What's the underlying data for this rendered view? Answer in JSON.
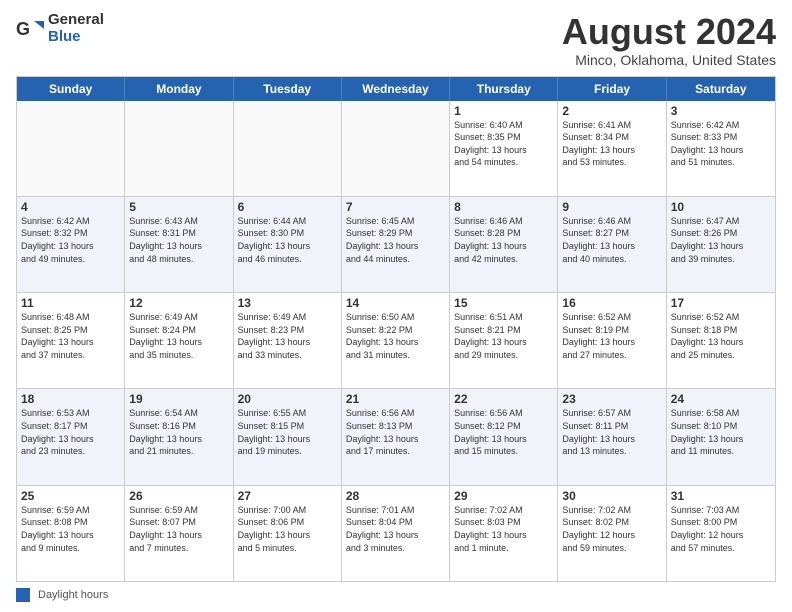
{
  "logo": {
    "general": "General",
    "blue": "Blue"
  },
  "title": "August 2024",
  "subtitle": "Minco, Oklahoma, United States",
  "days_of_week": [
    "Sunday",
    "Monday",
    "Tuesday",
    "Wednesday",
    "Thursday",
    "Friday",
    "Saturday"
  ],
  "weeks": [
    [
      {
        "day": "",
        "info": "",
        "empty": true
      },
      {
        "day": "",
        "info": "",
        "empty": true
      },
      {
        "day": "",
        "info": "",
        "empty": true
      },
      {
        "day": "",
        "info": "",
        "empty": true
      },
      {
        "day": "1",
        "info": "Sunrise: 6:40 AM\nSunset: 8:35 PM\nDaylight: 13 hours\nand 54 minutes.",
        "empty": false
      },
      {
        "day": "2",
        "info": "Sunrise: 6:41 AM\nSunset: 8:34 PM\nDaylight: 13 hours\nand 53 minutes.",
        "empty": false
      },
      {
        "day": "3",
        "info": "Sunrise: 6:42 AM\nSunset: 8:33 PM\nDaylight: 13 hours\nand 51 minutes.",
        "empty": false
      }
    ],
    [
      {
        "day": "4",
        "info": "Sunrise: 6:42 AM\nSunset: 8:32 PM\nDaylight: 13 hours\nand 49 minutes.",
        "empty": false
      },
      {
        "day": "5",
        "info": "Sunrise: 6:43 AM\nSunset: 8:31 PM\nDaylight: 13 hours\nand 48 minutes.",
        "empty": false
      },
      {
        "day": "6",
        "info": "Sunrise: 6:44 AM\nSunset: 8:30 PM\nDaylight: 13 hours\nand 46 minutes.",
        "empty": false
      },
      {
        "day": "7",
        "info": "Sunrise: 6:45 AM\nSunset: 8:29 PM\nDaylight: 13 hours\nand 44 minutes.",
        "empty": false
      },
      {
        "day": "8",
        "info": "Sunrise: 6:46 AM\nSunset: 8:28 PM\nDaylight: 13 hours\nand 42 minutes.",
        "empty": false
      },
      {
        "day": "9",
        "info": "Sunrise: 6:46 AM\nSunset: 8:27 PM\nDaylight: 13 hours\nand 40 minutes.",
        "empty": false
      },
      {
        "day": "10",
        "info": "Sunrise: 6:47 AM\nSunset: 8:26 PM\nDaylight: 13 hours\nand 39 minutes.",
        "empty": false
      }
    ],
    [
      {
        "day": "11",
        "info": "Sunrise: 6:48 AM\nSunset: 8:25 PM\nDaylight: 13 hours\nand 37 minutes.",
        "empty": false
      },
      {
        "day": "12",
        "info": "Sunrise: 6:49 AM\nSunset: 8:24 PM\nDaylight: 13 hours\nand 35 minutes.",
        "empty": false
      },
      {
        "day": "13",
        "info": "Sunrise: 6:49 AM\nSunset: 8:23 PM\nDaylight: 13 hours\nand 33 minutes.",
        "empty": false
      },
      {
        "day": "14",
        "info": "Sunrise: 6:50 AM\nSunset: 8:22 PM\nDaylight: 13 hours\nand 31 minutes.",
        "empty": false
      },
      {
        "day": "15",
        "info": "Sunrise: 6:51 AM\nSunset: 8:21 PM\nDaylight: 13 hours\nand 29 minutes.",
        "empty": false
      },
      {
        "day": "16",
        "info": "Sunrise: 6:52 AM\nSunset: 8:19 PM\nDaylight: 13 hours\nand 27 minutes.",
        "empty": false
      },
      {
        "day": "17",
        "info": "Sunrise: 6:52 AM\nSunset: 8:18 PM\nDaylight: 13 hours\nand 25 minutes.",
        "empty": false
      }
    ],
    [
      {
        "day": "18",
        "info": "Sunrise: 6:53 AM\nSunset: 8:17 PM\nDaylight: 13 hours\nand 23 minutes.",
        "empty": false
      },
      {
        "day": "19",
        "info": "Sunrise: 6:54 AM\nSunset: 8:16 PM\nDaylight: 13 hours\nand 21 minutes.",
        "empty": false
      },
      {
        "day": "20",
        "info": "Sunrise: 6:55 AM\nSunset: 8:15 PM\nDaylight: 13 hours\nand 19 minutes.",
        "empty": false
      },
      {
        "day": "21",
        "info": "Sunrise: 6:56 AM\nSunset: 8:13 PM\nDaylight: 13 hours\nand 17 minutes.",
        "empty": false
      },
      {
        "day": "22",
        "info": "Sunrise: 6:56 AM\nSunset: 8:12 PM\nDaylight: 13 hours\nand 15 minutes.",
        "empty": false
      },
      {
        "day": "23",
        "info": "Sunrise: 6:57 AM\nSunset: 8:11 PM\nDaylight: 13 hours\nand 13 minutes.",
        "empty": false
      },
      {
        "day": "24",
        "info": "Sunrise: 6:58 AM\nSunset: 8:10 PM\nDaylight: 13 hours\nand 11 minutes.",
        "empty": false
      }
    ],
    [
      {
        "day": "25",
        "info": "Sunrise: 6:59 AM\nSunset: 8:08 PM\nDaylight: 13 hours\nand 9 minutes.",
        "empty": false
      },
      {
        "day": "26",
        "info": "Sunrise: 6:59 AM\nSunset: 8:07 PM\nDaylight: 13 hours\nand 7 minutes.",
        "empty": false
      },
      {
        "day": "27",
        "info": "Sunrise: 7:00 AM\nSunset: 8:06 PM\nDaylight: 13 hours\nand 5 minutes.",
        "empty": false
      },
      {
        "day": "28",
        "info": "Sunrise: 7:01 AM\nSunset: 8:04 PM\nDaylight: 13 hours\nand 3 minutes.",
        "empty": false
      },
      {
        "day": "29",
        "info": "Sunrise: 7:02 AM\nSunset: 8:03 PM\nDaylight: 13 hours\nand 1 minute.",
        "empty": false
      },
      {
        "day": "30",
        "info": "Sunrise: 7:02 AM\nSunset: 8:02 PM\nDaylight: 12 hours\nand 59 minutes.",
        "empty": false
      },
      {
        "day": "31",
        "info": "Sunrise: 7:03 AM\nSunset: 8:00 PM\nDaylight: 12 hours\nand 57 minutes.",
        "empty": false
      }
    ]
  ],
  "footer": {
    "legend_label": "Daylight hours"
  }
}
